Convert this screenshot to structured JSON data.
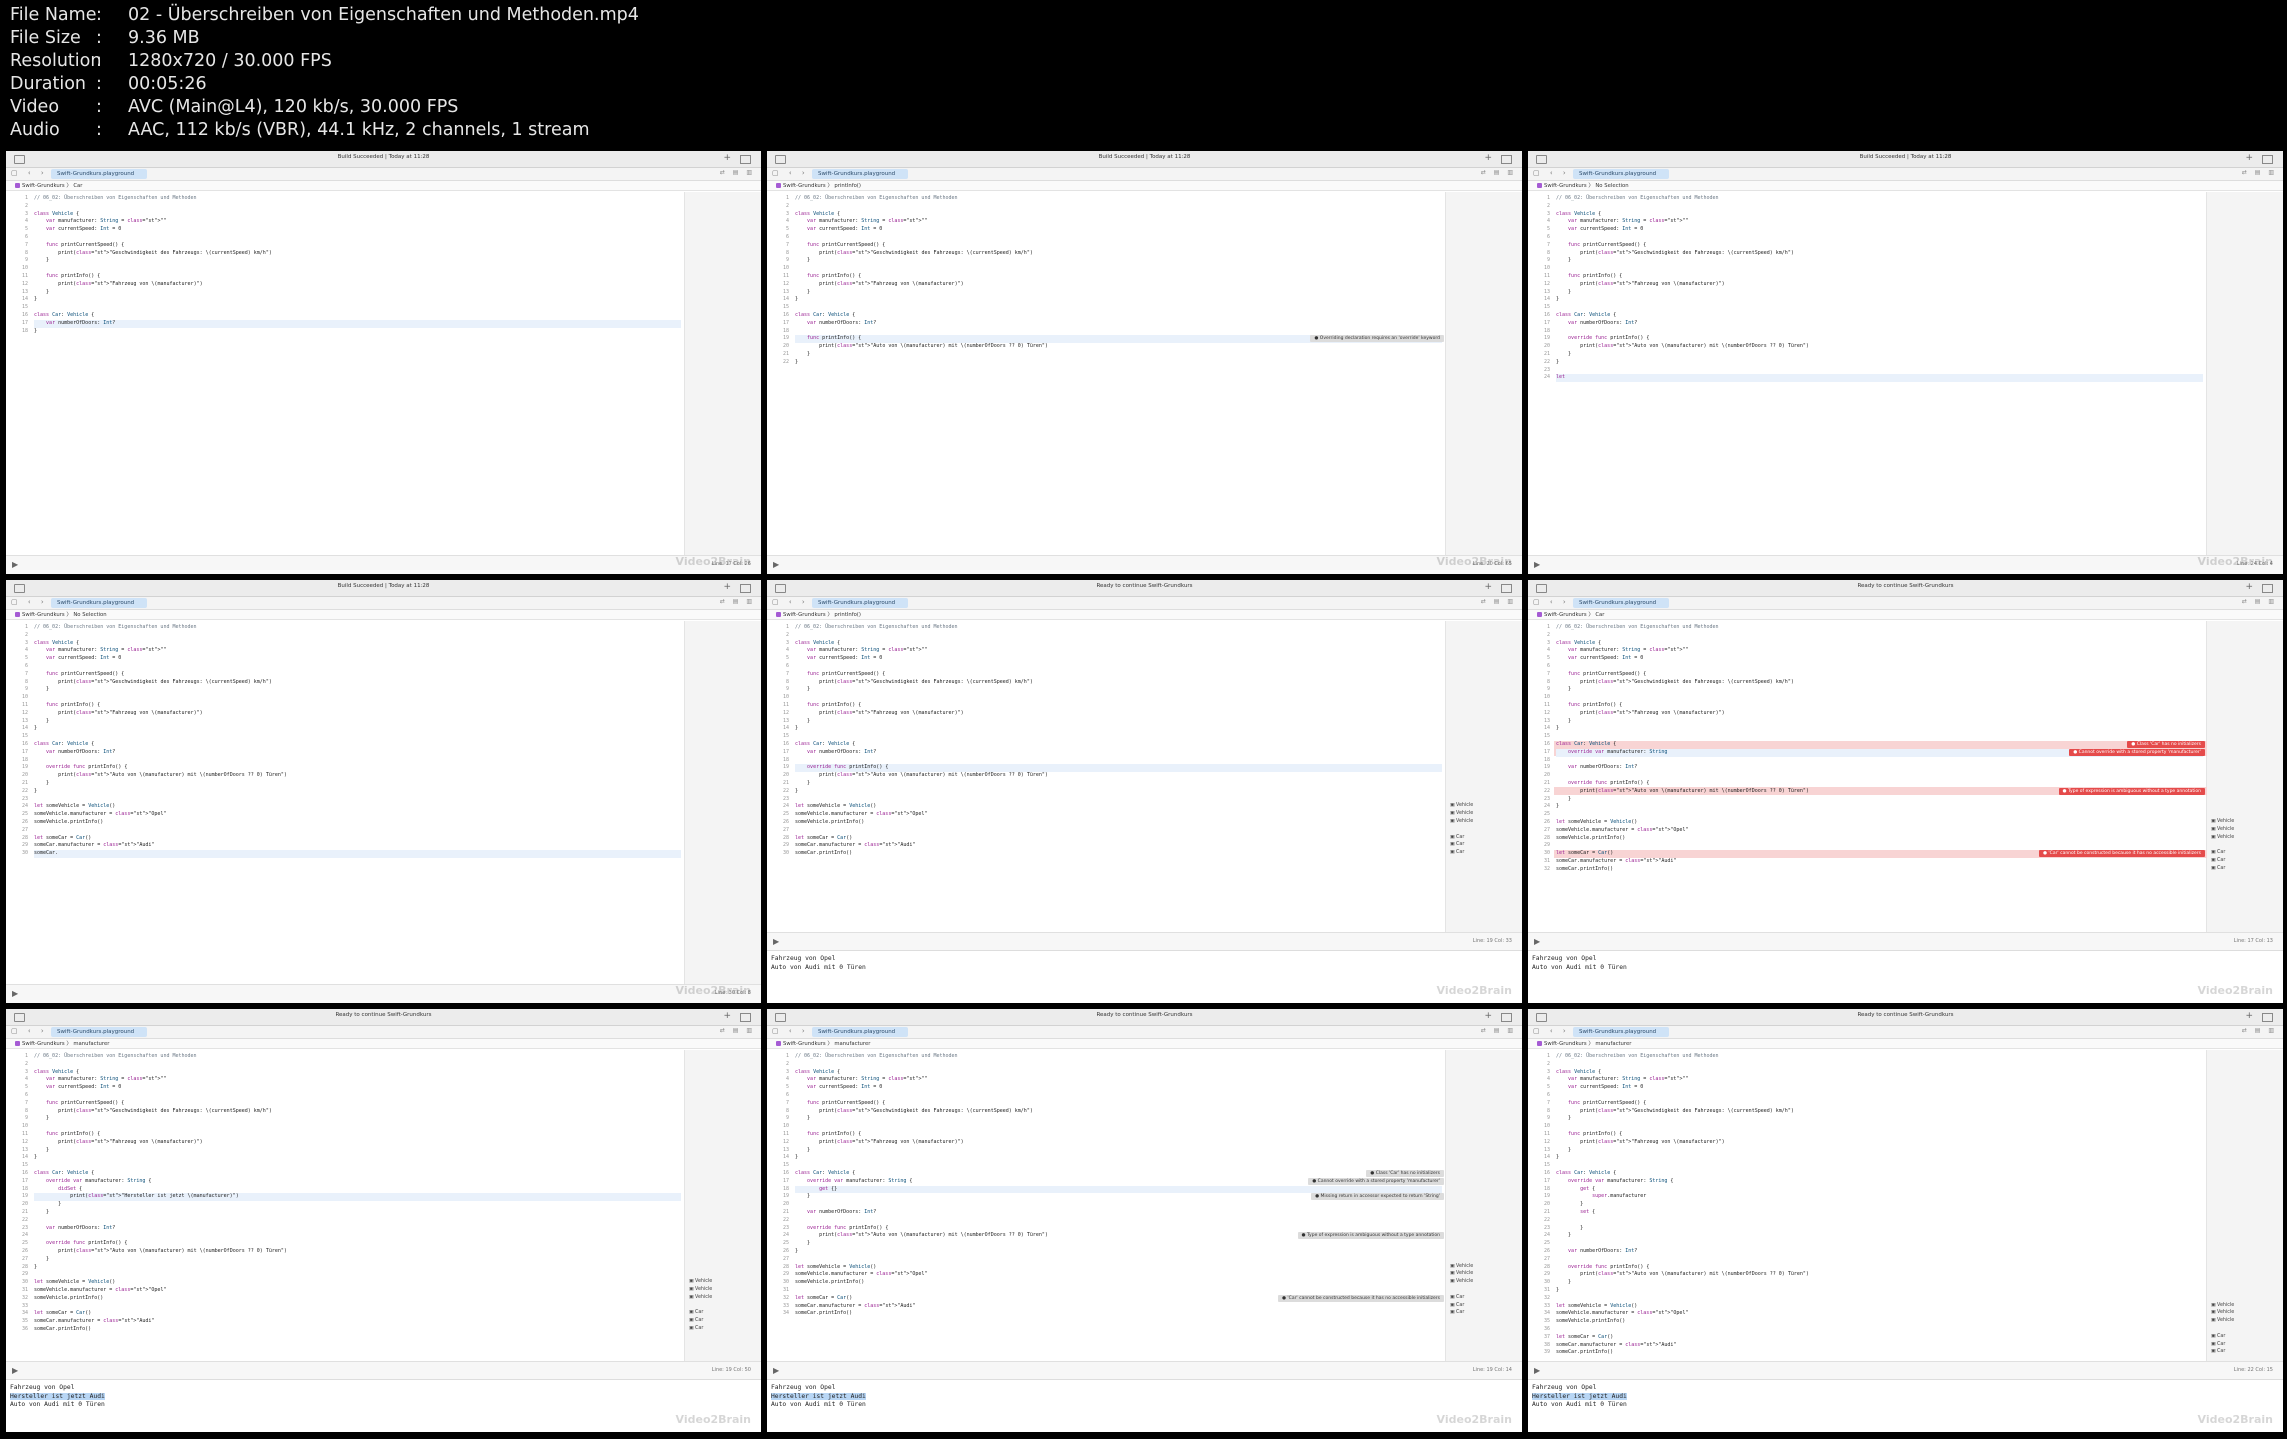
{
  "info": [
    {
      "key": "File Name",
      "value": "02 - Überschreiben von Eigenschaften und Methoden.mp4"
    },
    {
      "key": "File Size",
      "value": "9.36 MB"
    },
    {
      "key": "Resolution",
      "value": "1280x720 / 30.000 FPS"
    },
    {
      "key": "Duration",
      "value": "00:05:26"
    },
    {
      "key": "Video",
      "value": "AVC (Main@L4), 120 kb/s, 30.000 FPS"
    },
    {
      "key": "Audio",
      "value": "AAC, 112 kb/s (VBR), 44.1 kHz, 2 channels, 1 stream"
    }
  ],
  "info_separator": ":",
  "colors": {
    "accent": "#cfe3f7",
    "error": "#e54b4b",
    "error_line": "#f8d4d4",
    "selection": "#b8d6f5"
  },
  "icons": [
    "sidebar-icon",
    "plus-icon",
    "split-view-icon",
    "play-icon",
    "error-icon"
  ],
  "tab_label": "Swift-Grundkurs.playground",
  "watermark": "Video2Brain",
  "frames": [
    {
      "status": "Build Succeeded | Today at 11:28",
      "crumbs": "Swift-Grundkurs 〉 Car",
      "position": "Line: 17 Col: 26",
      "code": [
        "// 06_02: Überschreiben von Eigenschaften und Methoden",
        "",
        "class Vehicle {",
        "    var manufacturer: String = \"\"",
        "    var currentSpeed: Int = 0",
        "",
        "    func printCurrentSpeed() {",
        "        print(\"Geschwindigkeit des Fahrzeugs: \\(currentSpeed) km/h\")",
        "    }",
        "",
        "    func printInfo() {",
        "        print(\"Fahrzeug von \\(manufacturer)\")",
        "    }",
        "}",
        "",
        "class Car: Vehicle {",
        "    var numberOfDoors: Int?",
        "}"
      ],
      "highlight": 17,
      "errors": [],
      "results": [],
      "console": []
    },
    {
      "status": "Build Succeeded | Today at 11:28",
      "crumbs": "Swift-Grundkurs 〉 printInfo()",
      "position": "Line: 20 Col: 65",
      "code": [
        "// 06_02: Überschreiben von Eigenschaften und Methoden",
        "",
        "class Vehicle {",
        "    var manufacturer: String = \"\"",
        "    var currentSpeed: Int = 0",
        "",
        "    func printCurrentSpeed() {",
        "        print(\"Geschwindigkeit des Fahrzeugs: \\(currentSpeed) km/h\")",
        "    }",
        "",
        "    func printInfo() {",
        "        print(\"Fahrzeug von \\(manufacturer)\")",
        "    }",
        "}",
        "",
        "class Car: Vehicle {",
        "    var numberOfDoors: Int?",
        "",
        "    func printInfo() {",
        "        print(\"Auto von \\(manufacturer) mit \\(numberOfDoors ?? 0) Türen\")",
        "    }",
        "}"
      ],
      "highlight": 19,
      "errors": [
        {
          "line": 19,
          "msg": "Overriding declaration requires an 'override' keyword",
          "gray": true
        }
      ],
      "results": [],
      "console": []
    },
    {
      "status": "Build Succeeded | Today at 11:28",
      "crumbs": "Swift-Grundkurs 〉 No Selection",
      "position": "Line: 24 Col: 4",
      "code": [
        "// 06_02: Überschreiben von Eigenschaften und Methoden",
        "",
        "class Vehicle {",
        "    var manufacturer: String = \"\"",
        "    var currentSpeed: Int = 0",
        "",
        "    func printCurrentSpeed() {",
        "        print(\"Geschwindigkeit des Fahrzeugs: \\(currentSpeed) km/h\")",
        "    }",
        "",
        "    func printInfo() {",
        "        print(\"Fahrzeug von \\(manufacturer)\")",
        "    }",
        "}",
        "",
        "class Car: Vehicle {",
        "    var numberOfDoors: Int?",
        "",
        "    override func printInfo() {",
        "        print(\"Auto von \\(manufacturer) mit \\(numberOfDoors ?? 0) Türen\")",
        "    }",
        "}",
        "",
        "let"
      ],
      "highlight": 24,
      "errors": [],
      "results": [],
      "console": []
    },
    {
      "status": "Build Succeeded | Today at 11:28",
      "crumbs": "Swift-Grundkurs 〉 No Selection",
      "position": "Line: 30 Col: 8",
      "code": [
        "// 06_02: Überschreiben von Eigenschaften und Methoden",
        "",
        "class Vehicle {",
        "    var manufacturer: String = \"\"",
        "    var currentSpeed: Int = 0",
        "",
        "    func printCurrentSpeed() {",
        "        print(\"Geschwindigkeit des Fahrzeugs: \\(currentSpeed) km/h\")",
        "    }",
        "",
        "    func printInfo() {",
        "        print(\"Fahrzeug von \\(manufacturer)\")",
        "    }",
        "}",
        "",
        "class Car: Vehicle {",
        "    var numberOfDoors: Int?",
        "",
        "    override func printInfo() {",
        "        print(\"Auto von \\(manufacturer) mit \\(numberOfDoors ?? 0) Türen\")",
        "    }",
        "}",
        "",
        "let someVehicle = Vehicle()",
        "someVehicle.manufacturer = \"Opel\"",
        "someVehicle.printInfo()",
        "",
        "let someCar = Car()",
        "someCar.manufacturer = \"Audi\"",
        "someCar."
      ],
      "highlight": 30,
      "errors": [],
      "results": [],
      "console": []
    },
    {
      "status": "Ready to continue Swift-Grundkurs",
      "crumbs": "Swift-Grundkurs 〉 printInfo()",
      "position": "Line: 19 Col: 33",
      "code": [
        "// 06_02: Überschreiben von Eigenschaften und Methoden",
        "",
        "class Vehicle {",
        "    var manufacturer: String = \"\"",
        "    var currentSpeed: Int = 0",
        "",
        "    func printCurrentSpeed() {",
        "        print(\"Geschwindigkeit des Fahrzeugs: \\(currentSpeed) km/h\")",
        "    }",
        "",
        "    func printInfo() {",
        "        print(\"Fahrzeug von \\(manufacturer)\")",
        "    }",
        "}",
        "",
        "class Car: Vehicle {",
        "    var numberOfDoors: Int?",
        "",
        "    override func printInfo() {",
        "        print(\"Auto von \\(manufacturer) mit \\(numberOfDoors ?? 0) Türen\")",
        "    }",
        "}",
        "",
        "let someVehicle = Vehicle()",
        "someVehicle.manufacturer = \"Opel\"",
        "someVehicle.printInfo()",
        "",
        "let someCar = Car()",
        "someCar.manufacturer = \"Audi\"",
        "someCar.printInfo()"
      ],
      "highlight": 19,
      "errors": [],
      "results": [
        {
          "line": 24,
          "text": "Vehicle"
        },
        {
          "line": 25,
          "text": "Vehicle"
        },
        {
          "line": 26,
          "text": "Vehicle"
        },
        {
          "line": 28,
          "text": "Car"
        },
        {
          "line": 29,
          "text": "Car"
        },
        {
          "line": 30,
          "text": "Car"
        }
      ],
      "console": [
        {
          "text": "Fahrzeug von Opel",
          "sel": false
        },
        {
          "text": "Auto von Audi mit 0 Türen",
          "sel": false
        }
      ]
    },
    {
      "status": "Ready to continue Swift-Grundkurs",
      "crumbs": "Swift-Grundkurs 〉 Car",
      "position": "Line: 17 Col: 13",
      "code": [
        "// 06_02: Überschreiben von Eigenschaften und Methoden",
        "",
        "class Vehicle {",
        "    var manufacturer: String = \"\"",
        "    var currentSpeed: Int = 0",
        "",
        "    func printCurrentSpeed() {",
        "        print(\"Geschwindigkeit des Fahrzeugs: \\(currentSpeed) km/h\")",
        "    }",
        "",
        "    func printInfo() {",
        "        print(\"Fahrzeug von \\(manufacturer)\")",
        "    }",
        "}",
        "",
        "class Car: Vehicle {",
        "    override var manufacturer: String",
        "",
        "    var numberOfDoors: Int?",
        "",
        "    override func printInfo() {",
        "        print(\"Auto von \\(manufacturer) mit \\(numberOfDoors ?? 0) Türen\")",
        "    }",
        "}",
        "",
        "let someVehicle = Vehicle()",
        "someVehicle.manufacturer = \"Opel\"",
        "someVehicle.printInfo()",
        "",
        "let someCar = Car()",
        "someCar.manufacturer = \"Audi\"",
        "someCar.printInfo()"
      ],
      "highlight": 17,
      "errors": [
        {
          "line": 16,
          "msg": "Class 'Car' has no initializers",
          "gray": false
        },
        {
          "line": 17,
          "msg": "Cannot override with a stored property 'manufacturer'",
          "gray": false
        },
        {
          "line": 22,
          "msg": "Type of expression is ambiguous without a type annotation",
          "gray": false
        },
        {
          "line": 30,
          "msg": "'Car' cannot be constructed because it has no accessible initializers",
          "gray": false
        }
      ],
      "results": [
        {
          "line": 26,
          "text": "Vehicle"
        },
        {
          "line": 27,
          "text": "Vehicle"
        },
        {
          "line": 28,
          "text": "Vehicle"
        },
        {
          "line": 30,
          "text": "Car"
        },
        {
          "line": 31,
          "text": "Car"
        },
        {
          "line": 32,
          "text": "Car"
        }
      ],
      "console": [
        {
          "text": "Fahrzeug von Opel",
          "sel": false
        },
        {
          "text": "Auto von Audi mit 0 Türen",
          "sel": false
        }
      ]
    },
    {
      "status": "Ready to continue Swift-Grundkurs",
      "crumbs": "Swift-Grundkurs 〉 manufacturer",
      "position": "Line: 19 Col: 50",
      "code": [
        "// 06_02: Überschreiben von Eigenschaften und Methoden",
        "",
        "class Vehicle {",
        "    var manufacturer: String = \"\"",
        "    var currentSpeed: Int = 0",
        "",
        "    func printCurrentSpeed() {",
        "        print(\"Geschwindigkeit des Fahrzeugs: \\(currentSpeed) km/h\")",
        "    }",
        "",
        "    func printInfo() {",
        "        print(\"Fahrzeug von \\(manufacturer)\")",
        "    }",
        "}",
        "",
        "class Car: Vehicle {",
        "    override var manufacturer: String {",
        "        didSet {",
        "            print(\"Hersteller ist jetzt \\(manufacturer)\")",
        "        }",
        "    }",
        "",
        "    var numberOfDoors: Int?",
        "",
        "    override func printInfo() {",
        "        print(\"Auto von \\(manufacturer) mit \\(numberOfDoors ?? 0) Türen\")",
        "    }",
        "}",
        "",
        "let someVehicle = Vehicle()",
        "someVehicle.manufacturer = \"Opel\"",
        "someVehicle.printInfo()",
        "",
        "let someCar = Car()",
        "someCar.manufacturer = \"Audi\"",
        "someCar.printInfo()"
      ],
      "highlight": 19,
      "errors": [],
      "results": [
        {
          "line": 30,
          "text": "Vehicle"
        },
        {
          "line": 31,
          "text": "Vehicle"
        },
        {
          "line": 32,
          "text": "Vehicle"
        },
        {
          "line": 34,
          "text": "Car"
        },
        {
          "line": 35,
          "text": "Car"
        },
        {
          "line": 36,
          "text": "Car"
        }
      ],
      "console": [
        {
          "text": "Fahrzeug von Opel",
          "sel": false
        },
        {
          "text": "Hersteller ist jetzt Audi",
          "sel": true
        },
        {
          "text": "Auto von Audi mit 0 Türen",
          "sel": false
        }
      ]
    },
    {
      "status": "Ready to continue Swift-Grundkurs",
      "crumbs": "Swift-Grundkurs 〉 manufacturer",
      "position": "Line: 19 Col: 14",
      "code": [
        "// 06_02: Überschreiben von Eigenschaften und Methoden",
        "",
        "class Vehicle {",
        "    var manufacturer: String = \"\"",
        "    var currentSpeed: Int = 0",
        "",
        "    func printCurrentSpeed() {",
        "        print(\"Geschwindigkeit des Fahrzeugs: \\(currentSpeed) km/h\")",
        "    }",
        "",
        "    func printInfo() {",
        "        print(\"Fahrzeug von \\(manufacturer)\")",
        "    }",
        "}",
        "",
        "class Car: Vehicle {",
        "    override var manufacturer: String {",
        "        get {}",
        "    }",
        "",
        "    var numberOfDoors: Int?",
        "",
        "    override func printInfo() {",
        "        print(\"Auto von \\(manufacturer) mit \\(numberOfDoors ?? 0) Türen\")",
        "    }",
        "}",
        "",
        "let someVehicle = Vehicle()",
        "someVehicle.manufacturer = \"Opel\"",
        "someVehicle.printInfo()",
        "",
        "let someCar = Car()",
        "someCar.manufacturer = \"Audi\"",
        "someCar.printInfo()"
      ],
      "highlight": 18,
      "errors": [
        {
          "line": 16,
          "msg": "Class 'Car' has no initializers",
          "gray": true
        },
        {
          "line": 17,
          "msg": "Cannot override with a stored property 'manufacturer'",
          "gray": true
        },
        {
          "line": 19,
          "msg": "Missing return in accessor expected to return 'String'",
          "gray": true
        },
        {
          "line": 24,
          "msg": "Type of expression is ambiguous without a type annotation",
          "gray": true
        },
        {
          "line": 32,
          "msg": "'Car' cannot be constructed because it has no accessible initializers",
          "gray": true
        }
      ],
      "results": [
        {
          "line": 28,
          "text": "Vehicle"
        },
        {
          "line": 29,
          "text": "Vehicle"
        },
        {
          "line": 30,
          "text": "Vehicle"
        },
        {
          "line": 32,
          "text": "Car"
        },
        {
          "line": 33,
          "text": "Car"
        },
        {
          "line": 34,
          "text": "Car"
        }
      ],
      "console": [
        {
          "text": "Fahrzeug von Opel",
          "sel": false
        },
        {
          "text": "Hersteller ist jetzt Audi",
          "sel": true
        },
        {
          "text": "Auto von Audi mit 0 Türen",
          "sel": false
        }
      ]
    },
    {
      "status": "Ready to continue Swift-Grundkurs",
      "crumbs": "Swift-Grundkurs 〉 manufacturer",
      "position": "Line: 22 Col: 15",
      "code": [
        "// 06_02: Überschreiben von Eigenschaften und Methoden",
        "",
        "class Vehicle {",
        "    var manufacturer: String = \"\"",
        "    var currentSpeed: Int = 0",
        "",
        "    func printCurrentSpeed() {",
        "        print(\"Geschwindigkeit des Fahrzeugs: \\(currentSpeed) km/h\")",
        "    }",
        "",
        "    func printInfo() {",
        "        print(\"Fahrzeug von \\(manufacturer)\")",
        "    }",
        "}",
        "",
        "class Car: Vehicle {",
        "    override var manufacturer: String {",
        "        get {",
        "            super.manufacturer",
        "        }",
        "        set {",
        "",
        "        }",
        "    }",
        "",
        "    var numberOfDoors: Int?",
        "",
        "    override func printInfo() {",
        "        print(\"Auto von \\(manufacturer) mit \\(numberOfDoors ?? 0) Türen\")",
        "    }",
        "}",
        "",
        "let someVehicle = Vehicle()",
        "someVehicle.manufacturer = \"Opel\"",
        "someVehicle.printInfo()",
        "",
        "let someCar = Car()",
        "someCar.manufacturer = \"Audi\"",
        "someCar.printInfo()"
      ],
      "highlight": 22,
      "errors": [],
      "results": [
        {
          "line": 33,
          "text": "Vehicle"
        },
        {
          "line": 34,
          "text": "Vehicle"
        },
        {
          "line": 35,
          "text": "Vehicle"
        },
        {
          "line": 37,
          "text": "Car"
        },
        {
          "line": 38,
          "text": "Car"
        },
        {
          "line": 39,
          "text": "Car"
        }
      ],
      "console": [
        {
          "text": "Fahrzeug von Opel",
          "sel": false
        },
        {
          "text": "Hersteller ist jetzt Audi",
          "sel": true
        },
        {
          "text": "Auto von Audi mit 0 Türen",
          "sel": false
        }
      ]
    }
  ]
}
